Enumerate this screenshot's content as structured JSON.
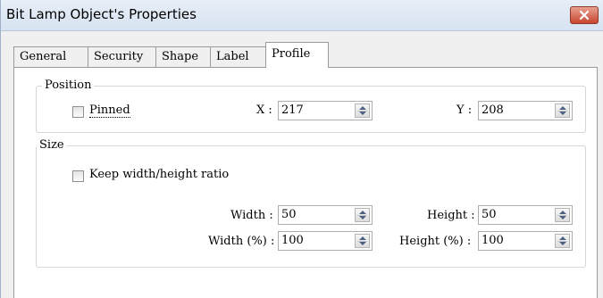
{
  "window": {
    "title": "Bit Lamp Object's Properties"
  },
  "tabs": [
    "General",
    "Security",
    "Shape",
    "Label",
    "Profile"
  ],
  "active_tab": "Profile",
  "position": {
    "group_label": "Position",
    "pinned_label": "Pinned",
    "pinned_checked": false,
    "x_label": "X :",
    "x_value": "217",
    "y_label": "Y :",
    "y_value": "208"
  },
  "size": {
    "group_label": "Size",
    "keep_ratio_label": "Keep width/height ratio",
    "keep_ratio_checked": false,
    "width_label": "Width :",
    "width_value": "50",
    "height_label": "Height :",
    "height_value": "50",
    "width_pct_label": "Width (%) :",
    "width_pct_value": "100",
    "height_pct_label": "Height (%) :",
    "height_pct_value": "100"
  }
}
